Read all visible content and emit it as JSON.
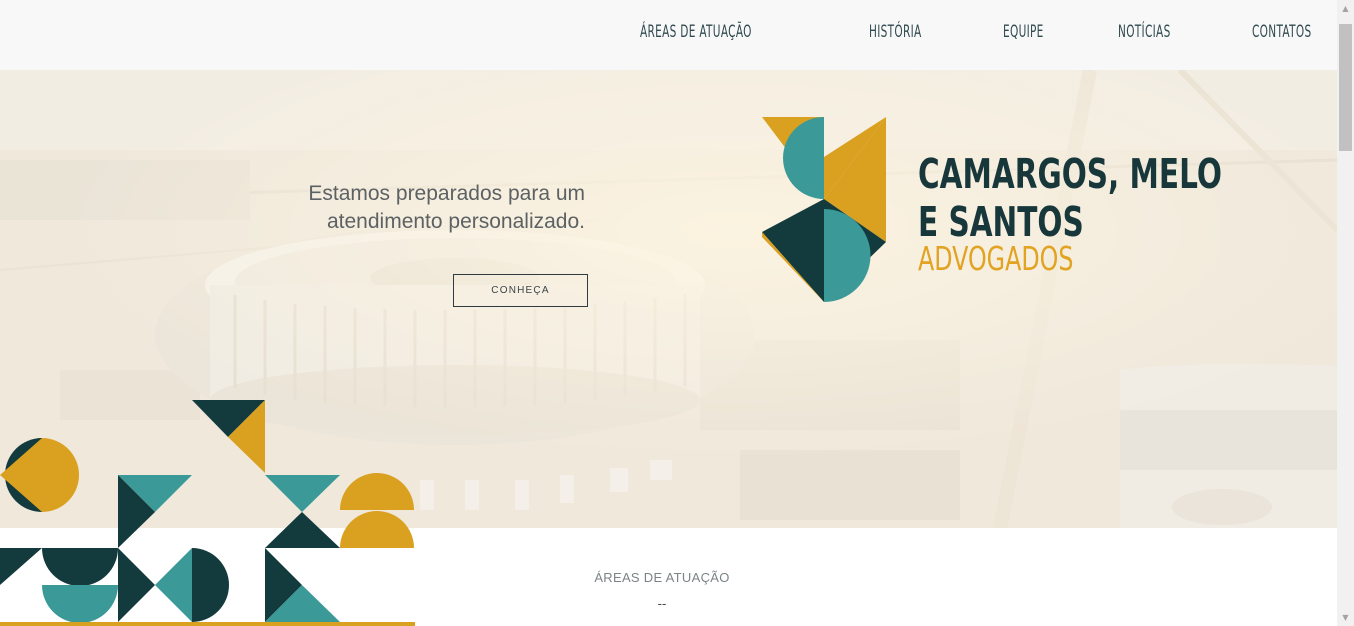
{
  "nav": {
    "items": [
      {
        "label": "ÁREAS DE ATUAÇÃO"
      },
      {
        "label": "HISTÓRIA"
      },
      {
        "label": "EQUIPE"
      },
      {
        "label": "NOTÍCIAS"
      },
      {
        "label": "CONTATOS"
      }
    ]
  },
  "hero": {
    "line1": "Estamos preparados para um",
    "line2": "atendimento personalizado.",
    "button_label": "CONHEÇA"
  },
  "brand": {
    "line1": "CAMARGOS, MELO",
    "line2": "E SANTOS",
    "line3": "ADVOGADOS",
    "colors": {
      "dark": "#133a3d",
      "teal": "#3b9a97",
      "gold": "#daa020"
    }
  },
  "section": {
    "title": "ÁREAS DE ATUAÇÃO",
    "separator": "--"
  },
  "scrollbar": {
    "up_icon": "▲",
    "down_icon": "▼"
  }
}
